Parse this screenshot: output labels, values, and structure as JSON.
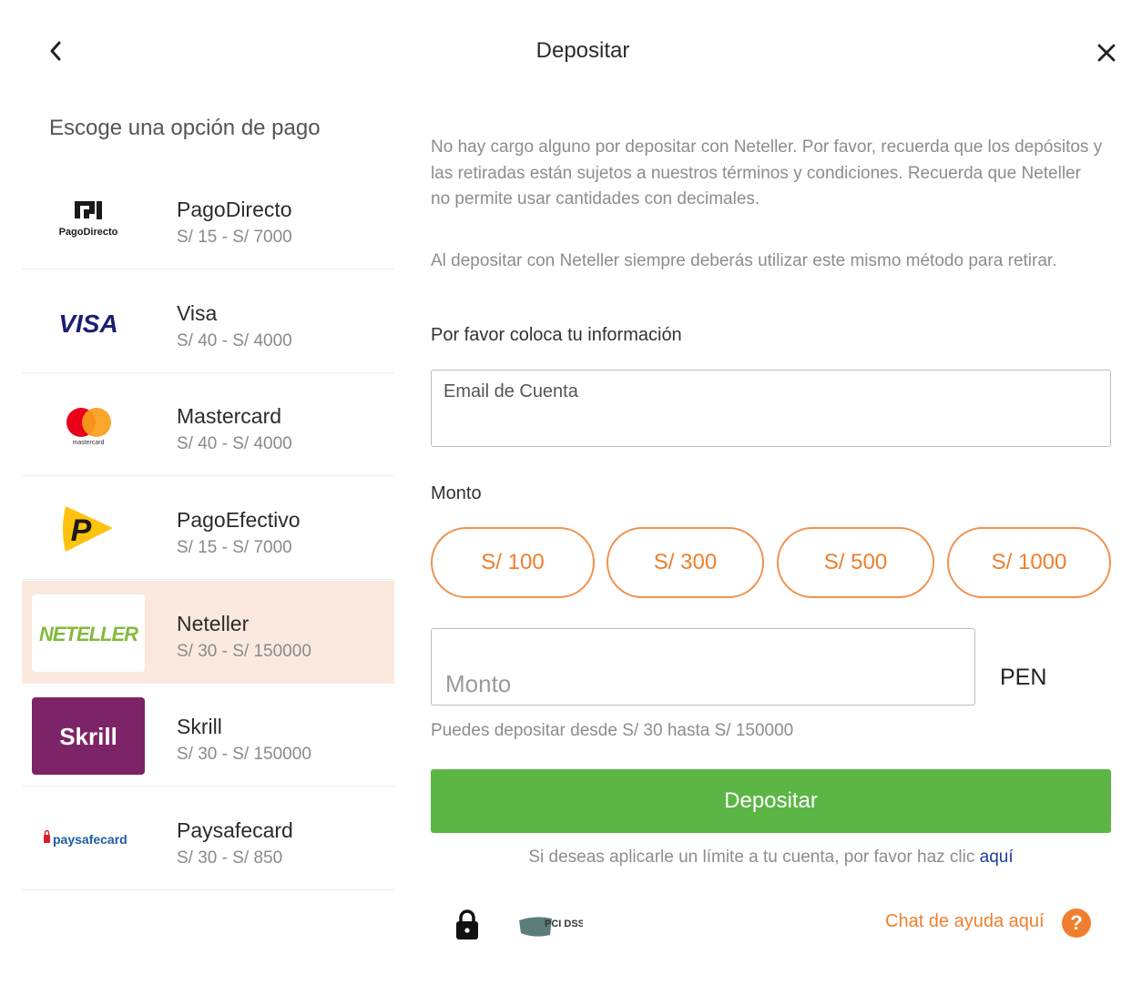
{
  "header": {
    "title": "Depositar"
  },
  "sidebar": {
    "heading": "Escoge una opción de pago",
    "methods": [
      {
        "name": "PagoDirecto",
        "range": "S/ 15 - S/ 7000",
        "logo_text": "PagoDirecto"
      },
      {
        "name": "Visa",
        "range": "S/ 40 - S/ 4000",
        "logo_text": "VISA"
      },
      {
        "name": "Mastercard",
        "range": "S/ 40 - S/ 4000",
        "logo_text": "mastercard"
      },
      {
        "name": "PagoEfectivo",
        "range": "S/ 15 - S/ 7000",
        "logo_text": "P"
      },
      {
        "name": "Neteller",
        "range": "S/ 30 - S/ 150000",
        "logo_text": "NETELLER"
      },
      {
        "name": "Skrill",
        "range": "S/ 30 - S/ 150000",
        "logo_text": "Skrill"
      },
      {
        "name": "Paysafecard",
        "range": "S/ 30 - S/ 850",
        "logo_text": "paysafecard"
      }
    ],
    "selected": "Neteller"
  },
  "content": {
    "info_1": "No hay cargo alguno por depositar con Neteller. Por favor, recuerda que los depósitos y las retiradas están sujetos a nuestros términos y condiciones. Recuerda que Neteller no permite usar cantidades con decimales.",
    "info_2": "Al depositar con Neteller siempre deberás utilizar este mismo método para retirar.",
    "form_heading": "Por favor coloca tu información",
    "email_label": "Email de Cuenta",
    "amount_label": "Monto",
    "amount_options": [
      "S/ 100",
      "S/ 300",
      "S/ 500",
      "S/ 1000"
    ],
    "amount_placeholder": "Monto",
    "currency": "PEN",
    "hint": "Puedes depositar desde S/ 30 hasta S/ 150000",
    "submit_label": "Depositar",
    "limit_text": "Si deseas aplicarle un límite a tu cuenta, por favor haz clic",
    "limit_link": "aquí"
  },
  "footer": {
    "pci_label": "PCI DSS",
    "help_label": "Chat de ayuda aquí",
    "help_icon_text": "?"
  },
  "colors": {
    "accent": "#ef7f2e",
    "submit": "#5cb646",
    "selected_bg": "#fbe9df",
    "link": "#1e3f9c"
  },
  "icons": [
    "chevron-left-icon",
    "close-icon",
    "lock-icon",
    "help-icon"
  ]
}
